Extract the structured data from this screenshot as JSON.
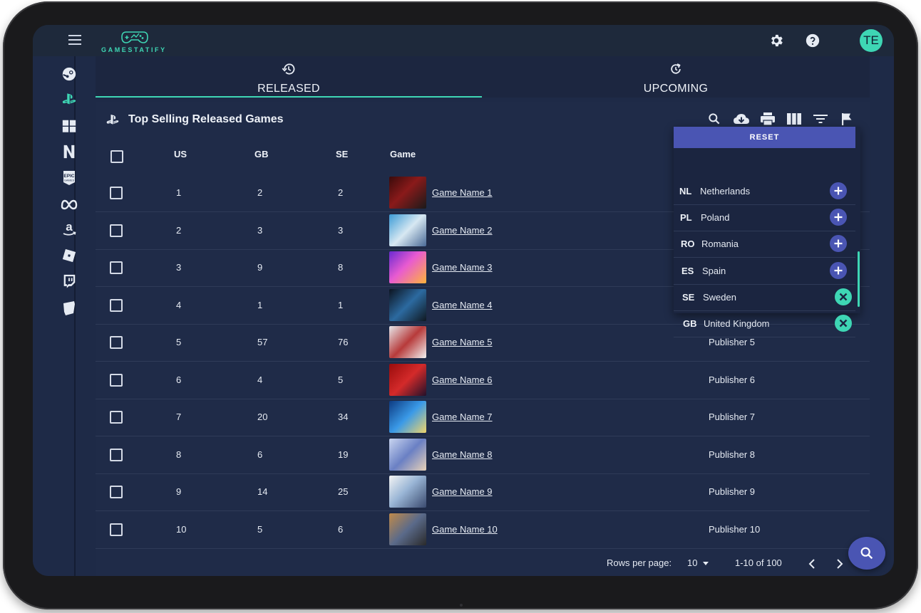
{
  "app": {
    "logo_text": "GAMESTATIFY",
    "avatar_initials": "TE"
  },
  "colors": {
    "accent": "#3ed6b4",
    "primary": "#4a55b3",
    "background": "#1e2a47"
  },
  "sidebar": {
    "items": [
      {
        "name": "steam-icon"
      },
      {
        "name": "playstation-icon",
        "active": true
      },
      {
        "name": "windows-icon"
      },
      {
        "name": "netflix-icon"
      },
      {
        "name": "epic-games-icon"
      },
      {
        "name": "meta-icon"
      },
      {
        "name": "amazon-icon"
      },
      {
        "name": "roblox-icon"
      },
      {
        "name": "twitch-icon"
      },
      {
        "name": "shield-icon"
      }
    ]
  },
  "tabs": [
    {
      "label": "RELEASED",
      "icon": "history-icon",
      "active": true
    },
    {
      "label": "UPCOMING",
      "icon": "refresh-icon",
      "active": false
    }
  ],
  "table": {
    "title": "Top Selling Released Games",
    "columns": [
      "US",
      "GB",
      "SE",
      "Game"
    ],
    "rows": [
      {
        "us": "1",
        "gb": "2",
        "se": "2",
        "game": "Game Name 1",
        "publisher": ""
      },
      {
        "us": "2",
        "gb": "3",
        "se": "3",
        "game": "Game Name 2",
        "publisher": ""
      },
      {
        "us": "3",
        "gb": "9",
        "se": "8",
        "game": "Game Name 3",
        "publisher": ""
      },
      {
        "us": "4",
        "gb": "1",
        "se": "1",
        "game": "Game Name 4",
        "publisher": ""
      },
      {
        "us": "5",
        "gb": "57",
        "se": "76",
        "game": "Game Name 5",
        "publisher": "Publisher 5"
      },
      {
        "us": "6",
        "gb": "4",
        "se": "5",
        "game": "Game Name 6",
        "publisher": "Publisher 6"
      },
      {
        "us": "7",
        "gb": "20",
        "se": "34",
        "game": "Game Name 7",
        "publisher": "Publisher 7"
      },
      {
        "us": "8",
        "gb": "6",
        "se": "19",
        "game": "Game Name 8",
        "publisher": "Publisher 8"
      },
      {
        "us": "9",
        "gb": "14",
        "se": "25",
        "game": "Game Name 9",
        "publisher": "Publisher 9"
      },
      {
        "us": "10",
        "gb": "5",
        "se": "6",
        "game": "Game Name 10",
        "publisher": "Publisher 10"
      }
    ],
    "pagination": {
      "rows_per_page_label": "Rows per page:",
      "rows_per_page": "10",
      "range": "1-10 of 100"
    }
  },
  "country_popup": {
    "reset_label": "RESET",
    "countries": [
      {
        "code": "NL",
        "name": "Netherlands",
        "selected": false
      },
      {
        "code": "PL",
        "name": "Poland",
        "selected": false
      },
      {
        "code": "RO",
        "name": "Romania",
        "selected": false
      },
      {
        "code": "ES",
        "name": "Spain",
        "selected": false
      },
      {
        "code": "SE",
        "name": "Sweden",
        "selected": true
      },
      {
        "code": "GB",
        "name": "United Kingdom",
        "selected": true
      }
    ]
  }
}
